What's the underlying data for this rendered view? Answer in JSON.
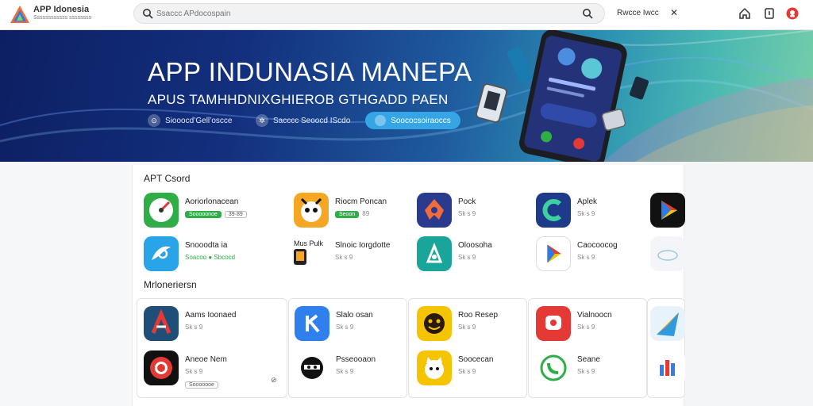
{
  "topbar": {
    "brand_name": "APP Idonesia",
    "brand_sub": "Ssssssssssss ssssssss",
    "search_placeholder": "Ssaccc APdocospain",
    "link": "Rwcce Iwcc",
    "close_glyph": "✕",
    "icons": [
      "home-icon",
      "download-icon",
      "profile-icon"
    ]
  },
  "hero": {
    "title": "APP INDUNASIA MANEPA",
    "subtitle": "APUS TAMHHDNIXGHIEROB GTHGADD PAEN",
    "pill1": "Siooocd’Gell’oscce",
    "pill2": "Sacccc Seoocd IScdo",
    "button": "Soococsoiraoccs"
  },
  "section1": {
    "title": "APT Csord",
    "apps": [
      {
        "name": "Aoriorlonacean",
        "meta_badge": "Sooooonoe",
        "meta_tag": "39·89",
        "icon": "gauge-icon",
        "color": "#2fae48"
      },
      {
        "name": "Riocm Poncan",
        "meta_badge": "Seoon",
        "meta_tag": "89",
        "icon": "mascot-icon",
        "color": "#f5a623"
      },
      {
        "name": "Pock",
        "meta": "Sk s 9",
        "icon": "dragon-icon",
        "color": "#2a3a8f"
      },
      {
        "name": "Aplek",
        "meta": "Sk s 9",
        "icon": "c-logo-icon",
        "color": "#1e3a8a"
      },
      {
        "name": "",
        "meta": "",
        "icon": "play-store-icon",
        "color": "#111111"
      },
      {
        "name": "Snooodta ia",
        "meta": "Soacoo ● Sbcocd",
        "icon": "swirl-icon",
        "color": "#2aa4e8"
      },
      {
        "name": "Slnoic Iorgdotte",
        "prefix": "Mus Pulk",
        "meta": "Sk s 9",
        "icon": "tablet-icon",
        "color": "#ffffff"
      },
      {
        "name": "Oloosoha",
        "meta": "Sk s 9",
        "icon": "leaf-icon",
        "color": "#1aa59a"
      },
      {
        "name": "Caocoocog",
        "meta": "Sk s 9",
        "icon": "play-icon",
        "color": "#ffffff"
      },
      {
        "name": "",
        "meta": "",
        "icon": "cloud-icon",
        "color": "#f6f7f9"
      }
    ]
  },
  "section2": {
    "title": "Mrloneriersn",
    "apps": [
      {
        "name": "Aams Ioonaed",
        "meta": "Sk s 9",
        "icon": "a-logo-icon",
        "color": "#1f4e79"
      },
      {
        "name": "Slalo osan",
        "meta": "Sk s 9",
        "icon": "k-logo-icon",
        "color": "#2f80ed"
      },
      {
        "name": "Roo Resep",
        "meta": "Sk s 9",
        "icon": "smile-icon",
        "color": "#f5c400"
      },
      {
        "name": "Vialnoocn",
        "meta": "Sk s 9",
        "icon": "chat-icon",
        "color": "#e53935"
      },
      {
        "name": "",
        "meta": "",
        "icon": "triangle-icon",
        "color": "#2f9ae0"
      },
      {
        "name": "Aneoe Nem",
        "meta": "Sk s 9",
        "meta_badge": "Sooooooe",
        "icon": "record-icon",
        "color": "#e53935"
      },
      {
        "name": "Psseooaon",
        "meta": "Sk s 9",
        "icon": "ninja-icon",
        "color": "#ffffff"
      },
      {
        "name": "Soocecan",
        "meta": "Sk s 9",
        "icon": "cat-icon",
        "color": "#f5c400"
      },
      {
        "name": "Seane",
        "meta": "Sk s 9",
        "icon": "phone-ring-icon",
        "color": "#ffffff"
      },
      {
        "name": "",
        "meta": "",
        "icon": "bars-icon",
        "color": "#ffffff"
      }
    ]
  }
}
